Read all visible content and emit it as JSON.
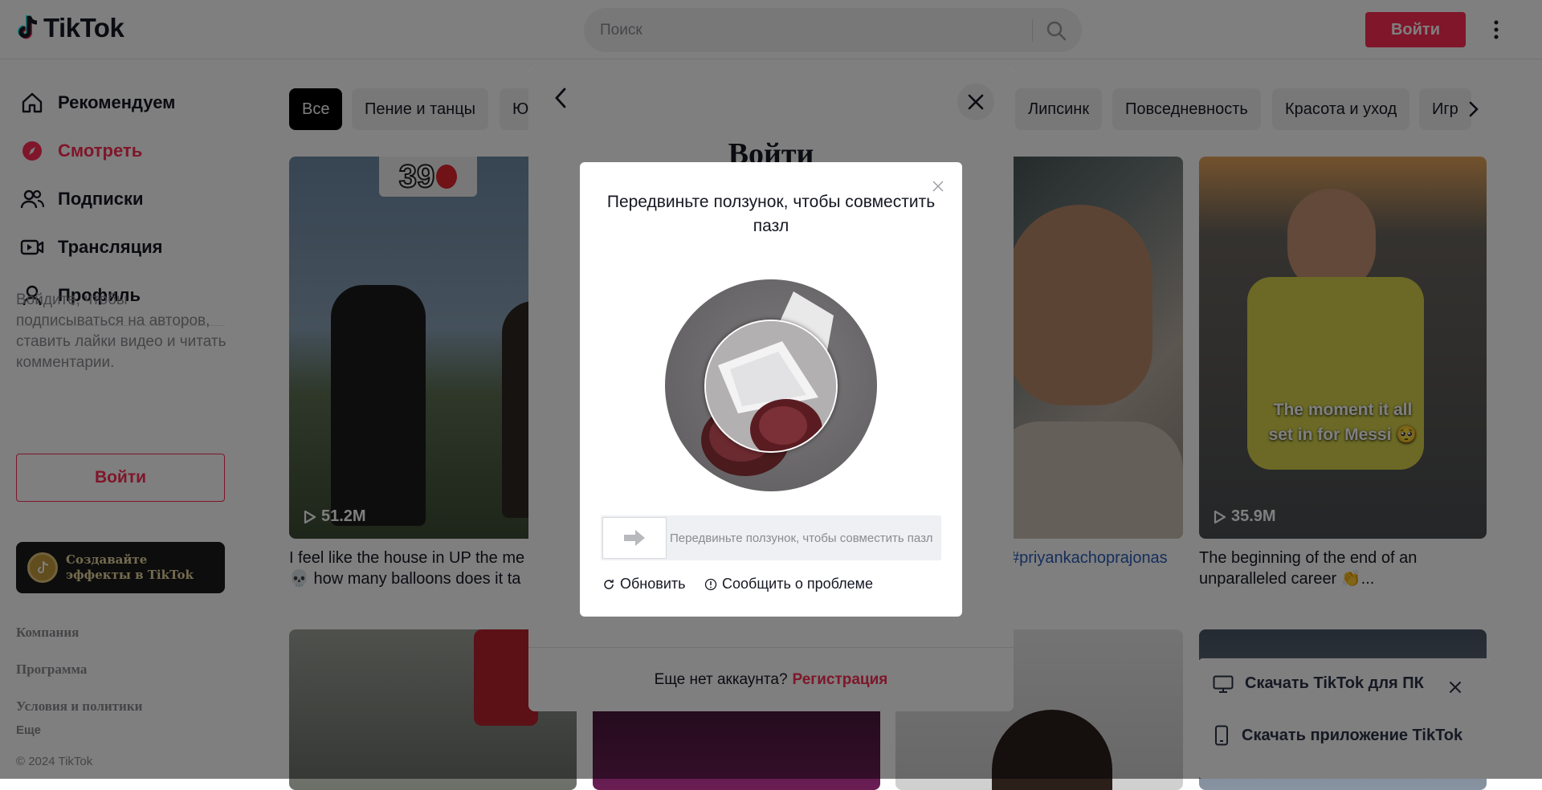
{
  "header": {
    "logo_text": "TikTok",
    "search_placeholder": "Поиск",
    "login_label": "Войти"
  },
  "sidebar": {
    "nav": [
      {
        "label": "Рекомендуем",
        "icon": "home-icon"
      },
      {
        "label": "Смотреть",
        "icon": "compass-icon",
        "active": true
      },
      {
        "label": "Подписки",
        "icon": "users-icon"
      },
      {
        "label": "Трансляция",
        "icon": "live-icon"
      },
      {
        "label": "Профиль",
        "icon": "user-icon"
      }
    ],
    "login_hint": "Войдите, чтобы подписываться на авторов, ставить лайки видео и читать комментарии.",
    "login_label": "Войти",
    "effects_label": "Создавайте эффекты в TikTok",
    "footer_links": [
      "Компания",
      "Программа",
      "Условия и политики"
    ],
    "more_label": "Еще",
    "copyright": "© 2024 TikTok"
  },
  "categories": [
    "Все",
    "Пение и танцы",
    "Ю",
    "Липсинк",
    "Повседневность",
    "Красота и уход",
    "Игр"
  ],
  "videos": [
    {
      "views": "51.2M",
      "caption": "I feel like the house in UP the me",
      "caption2": "💀 how many balloons does it ta",
      "overlay_number": "39"
    },
    {
      "views": "",
      "caption": "#priyankachoprajonas",
      "caption2": ""
    },
    {
      "views": "35.9M",
      "caption": "The beginning of the end of an",
      "caption2": "unparalleled career 👏...",
      "overlay_text": "The moment it all set in for Messi 🥺"
    }
  ],
  "login_modal": {
    "title": "Войти",
    "footer_text": "Еще нет аккаунта?",
    "signup_label": "Регистрация"
  },
  "captcha": {
    "title": "Передвиньте ползунок, чтобы совместить пазл",
    "slider_hint": "Передвиньте ползунок, чтобы совместить пазл",
    "refresh_label": "Обновить",
    "report_label": "Сообщить о проблеме"
  },
  "download": {
    "pc_label": "Скачать TikTok для ПК",
    "app_label": "Скачать приложение TikTok"
  },
  "colors": {
    "accent": "#fe2c55",
    "overlay": "rgba(0,0,0,0.5)",
    "hashtag": "#2b5db9"
  }
}
